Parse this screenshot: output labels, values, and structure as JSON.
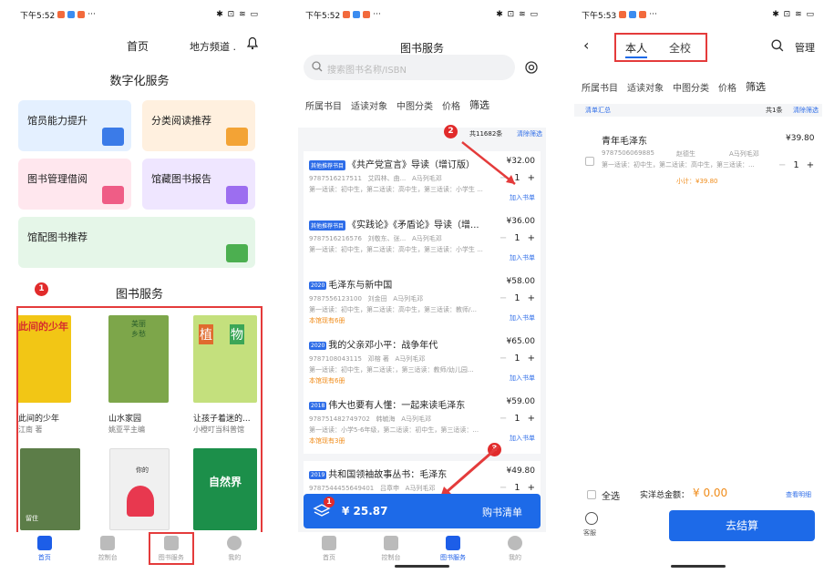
{
  "status": {
    "p1_time": "下午5:52",
    "p2_time": "下午5:52",
    "p3_time": "下午5:53",
    "dots": "···",
    "p1_right": "✱ ⊡ ≋ ▭",
    "p2_right": "✱ ⊡ ≋ ▭",
    "p3_right": "✱ ⊡ ≋ ▭"
  },
  "p1": {
    "header_title": "首页",
    "header_channel": "地方频道 .",
    "section_title": "数字化服务",
    "tiles": [
      {
        "label": "馆员能力提升",
        "bg": "#e4f0ff",
        "icon": "#3b7be8"
      },
      {
        "label": "分类阅读推荐",
        "bg": "#fff0df",
        "icon": "#f3a335"
      },
      {
        "label": "图书管理借阅",
        "bg": "#ffe7ee",
        "icon": "#ef5d86"
      },
      {
        "label": "馆藏图书报告",
        "bg": "#efe6ff",
        "icon": "#9c6ef0"
      },
      {
        "label": "馆配图书推荐",
        "bg": "#e5f6e8",
        "icon": "#4caf50"
      }
    ],
    "book_section_title": "图书服务",
    "books": [
      {
        "title": "此间的少年",
        "author": "江南 著",
        "cover": "#f2c615"
      },
      {
        "title": "山水家园",
        "author": "姚亚平主编",
        "cover": "#7da64a"
      },
      {
        "title": "让孩子着迷的...",
        "author": "小橙叮当科普馆",
        "cover": "#c4e07d"
      }
    ],
    "covers_row2": [
      "#5c7d48",
      "#f0f0f0",
      "#1c8f4a"
    ],
    "cover_texts": {
      "c1": "此间的少年",
      "c2a": "美丽",
      "c2b": "乡愁",
      "c3a": "植",
      "c3b": "物",
      "c5a": "留住",
      "c5b": "你的",
      "c6a": "自然界"
    },
    "markers": {
      "m1": "1",
      "m2": "2",
      "m3": "3"
    }
  },
  "nav": [
    {
      "label": "首页"
    },
    {
      "label": "控制台"
    },
    {
      "label": "图书服务"
    },
    {
      "label": "我的"
    }
  ],
  "p2": {
    "title": "图书服务",
    "search_placeholder": "搜索图书名称/ISBN",
    "filters": [
      "所属书目",
      "适读对象",
      "中图分类",
      "价格",
      "筛选"
    ],
    "total": "共11682条",
    "clear_filter": "清除筛选",
    "books": [
      {
        "tag": "其他推荐书目",
        "title": "《共产党宣言》导读（增订版）",
        "price": "¥32.00",
        "isbn": "9787516217511",
        "authors": "艾四林、曲...",
        "cls": "A马列毛邓",
        "readers": "第一适读：初中生，第二适读：高中生，第三适读：小学生 ...",
        "stock": "",
        "qty": "1",
        "add": "加入书单"
      },
      {
        "tag": "其他推荐书目",
        "title": "《实践论》《矛盾论》导读（增...",
        "price": "¥36.00",
        "isbn": "9787516216576",
        "authors": "刘敬东、张...",
        "cls": "A马列毛邓",
        "readers": "第一适读：初中生，第二适读：高中生，第三适读：小学生 ...",
        "stock": "",
        "qty": "1",
        "add": "加入书单"
      },
      {
        "tag": "2020",
        "title": "毛泽东与新中国",
        "price": "¥58.00",
        "isbn": "9787556123100",
        "authors": "刘金田",
        "cls": "A马列毛邓",
        "readers": "第一适读：初中生，第二适读：高中生，第三适读：教师/...",
        "stock": "本馆现有6册",
        "qty": "1",
        "add": "加入书单"
      },
      {
        "tag": "2020",
        "title": "我的父亲邓小平：战争年代",
        "price": "¥65.00",
        "isbn": "9787108043115",
        "authors": "邓榕 著",
        "cls": "A马列毛邓",
        "readers": "第一适读：初中生，第二适读：，第三适读：教师/幼儿园...",
        "stock": "本馆现有6册",
        "qty": "1",
        "add": "加入书单"
      },
      {
        "tag": "2018",
        "title": "伟大也要有人懂：一起来读毛泽东",
        "price": "¥59.00",
        "isbn": "9787514827497​02",
        "authors": "韩毓海",
        "cls": "A马列毛邓",
        "readers": "第一适读：小学5-6年级，第二适读：初中生，第三适读：...",
        "stock": "本馆现有3册",
        "qty": "1",
        "add": "加入书单"
      },
      {
        "tag": "2019",
        "title": "共和国领袖故事丛书：毛泽东",
        "price": "¥49.80",
        "isbn": "9787544455649401",
        "authors": "吕章申",
        "cls": "A马列毛邓",
        "readers": "",
        "stock": "",
        "qty": "1",
        "add": ""
      }
    ],
    "cart_badge": "1",
    "cart_total": "¥ 25.87",
    "cart_button": "购书清单"
  },
  "p3": {
    "tab_self": "本人",
    "tab_school": "全校",
    "manage": "管理",
    "filters": [
      "所属书目",
      "适读对象",
      "中图分类",
      "价格",
      "筛选"
    ],
    "list_summary": "清单汇总",
    "count": "共1条",
    "clear_filter": "清除筛选",
    "item": {
      "title": "青年毛泽东",
      "price": "¥39.80",
      "isbn": "9787506069885",
      "author": "赵德生",
      "cls": "A马列毛邓",
      "readers": "第一适读：初中生，第二适读：高中生，第三适读：...",
      "qty": "1",
      "subtotal": "小计：¥39.80"
    },
    "select_all": "全选",
    "total_label": "实洋总金额：",
    "total_value": "¥ 0.00",
    "detail": "查看明细",
    "service": "客服",
    "checkout": "去结算"
  },
  "colors": {
    "accent": "#1d6ae8",
    "red": "#e43b3b",
    "orange": "#f08c1a"
  }
}
